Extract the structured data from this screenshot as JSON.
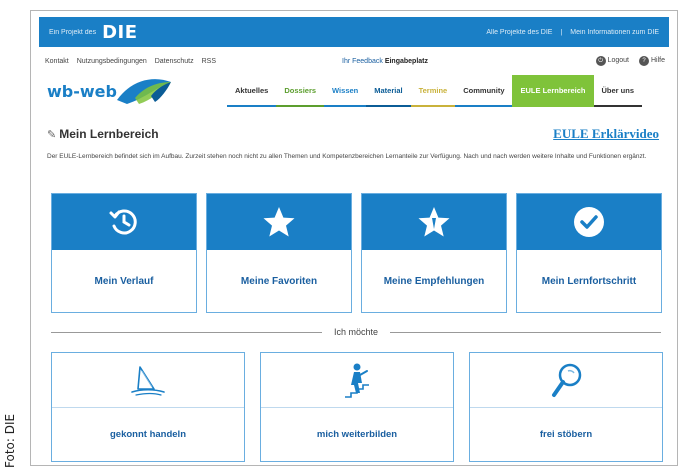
{
  "credit": "Foto: DIE",
  "topbar": {
    "projekt": "Ein Projekt des",
    "die_logo": "DIE",
    "right_links": [
      "Alle Projekte des DIE",
      "|",
      "Mein Informationen zum DIE"
    ]
  },
  "meta": {
    "links": [
      "Kontakt",
      "Nutzungsbedingungen",
      "Datenschutz",
      "RSS"
    ],
    "feedback_prefix": "Ihr Feedback",
    "feedback_link": "Eingabeplatz",
    "logout": "Logout",
    "help": "Hilfe"
  },
  "brand": "wb-web",
  "nav": [
    "Aktuelles",
    "Dossiers",
    "Wissen",
    "Material",
    "Termine",
    "Community",
    "EULE Lernbereich",
    "Über uns"
  ],
  "page": {
    "title": "Mein Lernbereich",
    "video_link": "EULE Erklärvideo",
    "intro": "Der EULE-Lernbereich befindet sich im Aufbau. Zurzeit stehen noch nicht zu allen Themen und Kompetenzbereichen Lernanteile zur Verfügung. Nach und nach werden weitere Inhalte und Funktionen ergänzt."
  },
  "tiles": [
    {
      "label": "Mein Verlauf",
      "icon": "history-icon"
    },
    {
      "label": "Meine Favoriten",
      "icon": "star-icon"
    },
    {
      "label": "Meine Empfehlungen",
      "icon": "star-thumb-icon"
    },
    {
      "label": "Mein Lernfortschritt",
      "icon": "check-circle-icon"
    }
  ],
  "divider": "Ich möchte",
  "want": [
    {
      "label": "gekonnt handeln",
      "icon": "sailboat-icon"
    },
    {
      "label": "mich weiterbilden",
      "icon": "stairs-climber-icon"
    },
    {
      "label": "frei stöbern",
      "icon": "magnifier-icon"
    }
  ],
  "colors": {
    "primary": "#1a7fc6",
    "active_nav": "#7fc33a"
  }
}
